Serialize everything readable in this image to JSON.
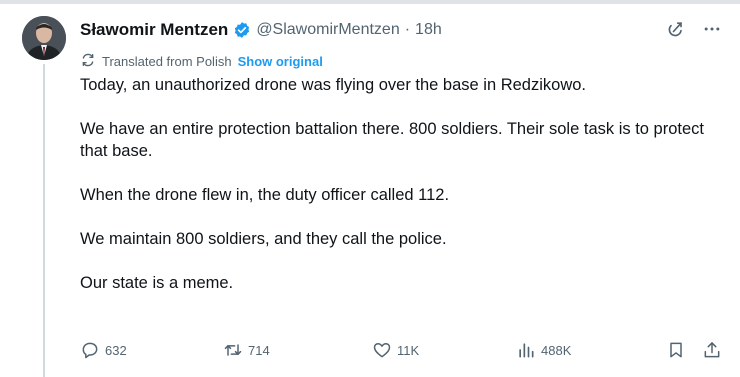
{
  "author": {
    "name": "Sławomir Mentzen",
    "handle": "@SlawomirMentzen",
    "separator": "·",
    "time": "18h"
  },
  "translation": {
    "note": "Translated from Polish",
    "show_original": "Show original"
  },
  "body": {
    "paragraphs": [
      "Today, an unauthorized drone was flying over the base in Redzikowo.",
      "We have an entire protection battalion there. 800 soldiers. Their sole task is to protect that base.",
      "When the drone flew in, the duty officer called 112.",
      "We maintain 800 soldiers, and they call the police.",
      "Our state is a meme."
    ]
  },
  "actions": {
    "replies": "632",
    "reposts": "714",
    "likes": "11K",
    "views": "488K"
  },
  "icons": {
    "verified": "verified-badge-icon",
    "grok": "grok-icon",
    "more": "more-icon",
    "translate": "translate-icon",
    "reply": "reply-icon",
    "repost": "repost-icon",
    "like": "like-icon",
    "views": "views-icon",
    "bookmark": "bookmark-icon",
    "share": "share-icon"
  },
  "colors": {
    "text": "#0f1419",
    "secondary": "#536471",
    "accent": "#1d9bf0"
  }
}
